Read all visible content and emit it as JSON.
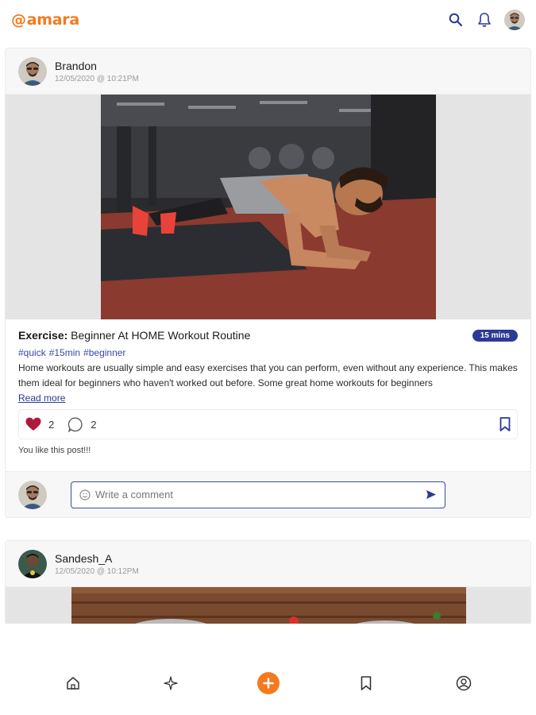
{
  "app": {
    "logo_text": "amara",
    "logo_symbol": "@",
    "brand_color": "#f47a20",
    "accent_color": "#2b3a96"
  },
  "topbar": {
    "icons": [
      "search-icon",
      "bell-icon",
      "user-avatar"
    ]
  },
  "posts": [
    {
      "author": "Brandon",
      "timestamp": "12/05/2020 @ 10:21PM",
      "category": "Exercise:",
      "title": "Beginner At HOME Workout Routine",
      "duration": "15 mins",
      "hashtags": [
        "#quick",
        "#15min",
        "#beginner"
      ],
      "excerpt": "Home workouts are usually simple and easy exercises that you can perform, even without any experience. This makes them ideal for beginners who haven't worked out before. Some great home workouts for beginners",
      "read_more": "Read more",
      "likes": "2",
      "comments": "2",
      "liked_note": "You like this post!!!",
      "comment_placeholder": "Write a comment"
    },
    {
      "author": "Sandesh_A",
      "timestamp": "12/05/2020 @ 10:12PM"
    }
  ],
  "bottom_nav": {
    "items": [
      "home-icon",
      "sparkle-icon",
      "add-post-icon",
      "bookmarks-icon",
      "profile-icon"
    ]
  }
}
